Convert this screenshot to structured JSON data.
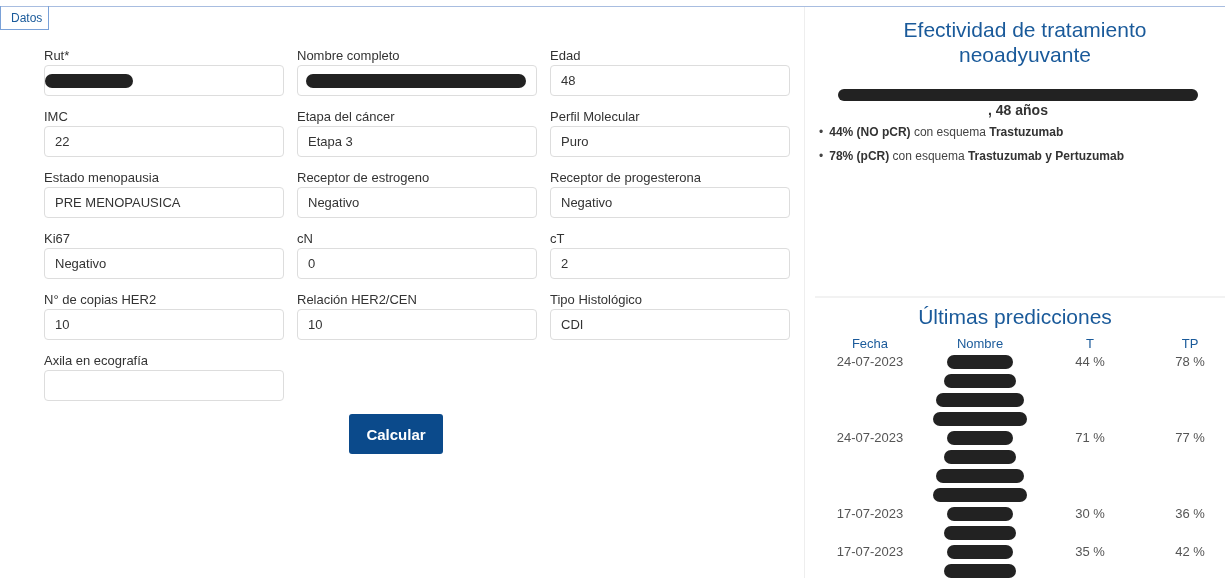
{
  "tabs": [
    {
      "label": "Datos",
      "selected": true
    }
  ],
  "form": {
    "fields": [
      {
        "label": "Rut*",
        "redacted": true
      },
      {
        "label": "Nombre completo",
        "redacted": true
      },
      {
        "label": "Edad",
        "value": "48",
        "redacted": false
      },
      {
        "label": "IMC",
        "value": "22",
        "redacted": false
      },
      {
        "label": "Etapa del cáncer",
        "value": "Etapa 3",
        "redacted": false
      },
      {
        "label": "Perfil Molecular",
        "value": "Puro",
        "redacted": false
      },
      {
        "label": "Estado menopausia",
        "value": "PRE MENOPAUSICA",
        "redacted": false
      },
      {
        "label": "Receptor de estrogeno",
        "value": "Negativo",
        "redacted": false
      },
      {
        "label": "Receptor de progesterona",
        "value": "Negativo",
        "redacted": false
      },
      {
        "label": "Ki67",
        "value": "Negativo",
        "redacted": false
      },
      {
        "label": "cN",
        "value": "0",
        "redacted": false
      },
      {
        "label": "cT",
        "value": "2",
        "redacted": false
      },
      {
        "label": "N° de copias HER2",
        "value": "10",
        "redacted": false
      },
      {
        "label": "Relación HER2/CEN",
        "value": "10",
        "redacted": false
      },
      {
        "label": "Tipo Histológico",
        "value": "CDI",
        "redacted": false
      },
      {
        "label": "Axila en ecografía",
        "redacted": false
      }
    ],
    "submit": "Calcular"
  },
  "result": {
    "title": "Efectividad de tratamiento neoadyuvante",
    "patient_redacted": true,
    "patient_suffix": ", 48 años",
    "items": [
      {
        "marker": "•",
        "text": "**44% (NO pCR)** con esquema **Trastuzumab**"
      },
      {
        "marker": "•",
        "text": "**78% (pCR)** con esquema **Trastuzumab y Pertuzumab**"
      }
    ]
  },
  "predictions": {
    "title": "Últimas predicciones",
    "columns": [
      "Fecha",
      "Nombre",
      "T",
      "TP"
    ],
    "rows": [
      {
        "date": "24-07-2023",
        "name_marks": [
          {
            "kind": "redaction"
          },
          {
            "kind": "redaction"
          },
          {
            "kind": "redaction"
          },
          {
            "kind": "redaction"
          }
        ],
        "t": "44 %",
        "tp": "78 %"
      },
      {
        "date": "24-07-2023",
        "name_marks": [
          {
            "kind": "redaction"
          },
          {
            "kind": "redaction"
          },
          {
            "kind": "redaction"
          },
          {
            "kind": "redaction"
          }
        ],
        "t": "71 %",
        "tp": "77 %"
      },
      {
        "date": "17-07-2023",
        "name_marks": [
          {
            "kind": "redaction"
          },
          {
            "kind": "redaction"
          }
        ],
        "t": "30 %",
        "tp": "36 %"
      },
      {
        "date": "17-07-2023",
        "name_marks": [
          {
            "kind": "redaction"
          },
          {
            "kind": "redaction"
          }
        ],
        "t": "35 %",
        "tp": "42 %"
      }
    ]
  }
}
